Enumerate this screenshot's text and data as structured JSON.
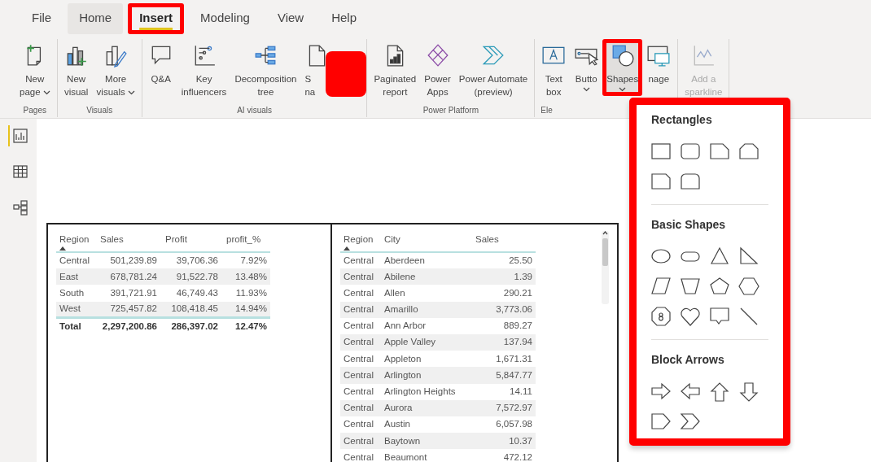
{
  "tabs": [
    {
      "label": "File",
      "selected": false,
      "hovered": false,
      "highlighted": false
    },
    {
      "label": "Home",
      "selected": false,
      "hovered": true,
      "highlighted": false
    },
    {
      "label": "Insert",
      "selected": true,
      "hovered": false,
      "highlighted": true
    },
    {
      "label": "Modeling",
      "selected": false,
      "hovered": false,
      "highlighted": false
    },
    {
      "label": "View",
      "selected": false,
      "hovered": false,
      "highlighted": false
    },
    {
      "label": "Help",
      "selected": false,
      "hovered": false,
      "highlighted": false
    }
  ],
  "ribbon_groups": [
    {
      "label": "Pages",
      "buttons": [
        {
          "lines": [
            "New",
            "page"
          ],
          "dropdown": true
        }
      ]
    },
    {
      "label": "Visuals",
      "buttons": [
        {
          "lines": [
            "New",
            "visual"
          ]
        },
        {
          "lines": [
            "More",
            "visuals"
          ],
          "dropdown": true
        }
      ]
    },
    {
      "label": "AI visuals",
      "buttons": [
        {
          "lines": [
            "Q&A"
          ]
        },
        {
          "lines": [
            "Key",
            "influencers"
          ]
        },
        {
          "lines": [
            "Decomposition",
            "tree"
          ]
        },
        {
          "lines": [
            "S",
            "na"
          ],
          "redacted": true
        }
      ]
    },
    {
      "label": "Power Platform",
      "buttons": [
        {
          "lines": [
            "Paginated",
            "report"
          ]
        },
        {
          "lines": [
            "Power",
            "Apps"
          ]
        },
        {
          "lines": [
            "Power Automate",
            "(preview)"
          ]
        }
      ]
    },
    {
      "label": "Ele",
      "buttons": [
        {
          "lines": [
            "Text",
            "box"
          ]
        },
        {
          "lines": [
            "Butto"
          ],
          "dropdown": true
        },
        {
          "lines": [
            "Shapes"
          ],
          "dropdown": true,
          "highlighted": true
        },
        {
          "lines": [
            "nage"
          ]
        }
      ]
    },
    {
      "buttons": [
        {
          "lines": [
            "Add a",
            "sparkline"
          ],
          "disabled": true
        }
      ]
    }
  ],
  "view_rail": [
    {
      "selected": true
    },
    {
      "selected": false
    },
    {
      "selected": false
    }
  ],
  "summary_table": {
    "columns": [
      {
        "label": "Region",
        "sorted": true
      },
      {
        "label": "Sales",
        "sorted": false
      },
      {
        "label": "Profit",
        "sorted": false
      },
      {
        "label": "profit_%",
        "sorted": false
      }
    ],
    "rows": [
      [
        "Central",
        "501,239.89",
        "39,706.36",
        "7.92%"
      ],
      [
        "East",
        "678,781.24",
        "91,522.78",
        "13.48%"
      ],
      [
        "South",
        "391,721.91",
        "46,749.43",
        "11.93%"
      ],
      [
        "West",
        "725,457.82",
        "108,418.45",
        "14.94%"
      ]
    ],
    "total": [
      "Total",
      "2,297,200.86",
      "286,397.02",
      "12.47%"
    ]
  },
  "city_table": {
    "columns": [
      {
        "label": "Region",
        "sorted": true
      },
      {
        "label": "City",
        "sorted": false
      },
      {
        "label": "Sales",
        "sorted": false
      }
    ],
    "rows": [
      [
        "Central",
        "Aberdeen",
        "25.50"
      ],
      [
        "Central",
        "Abilene",
        "1.39"
      ],
      [
        "Central",
        "Allen",
        "290.21"
      ],
      [
        "Central",
        "Amarillo",
        "3,773.06"
      ],
      [
        "Central",
        "Ann Arbor",
        "889.27"
      ],
      [
        "Central",
        "Apple Valley",
        "137.94"
      ],
      [
        "Central",
        "Appleton",
        "1,671.31"
      ],
      [
        "Central",
        "Arlington",
        "5,847.77"
      ],
      [
        "Central",
        "Arlington Heights",
        "14.11"
      ],
      [
        "Central",
        "Aurora",
        "7,572.97"
      ],
      [
        "Central",
        "Austin",
        "6,057.98"
      ],
      [
        "Central",
        "Baytown",
        "10.37"
      ],
      [
        "Central",
        "Beaumont",
        "472.12"
      ]
    ]
  },
  "shapes_menu": {
    "highlighted": true,
    "sections": [
      {
        "title": "Rectangles"
      },
      {
        "title": "Basic Shapes"
      },
      {
        "title": "Block Arrows"
      }
    ]
  }
}
